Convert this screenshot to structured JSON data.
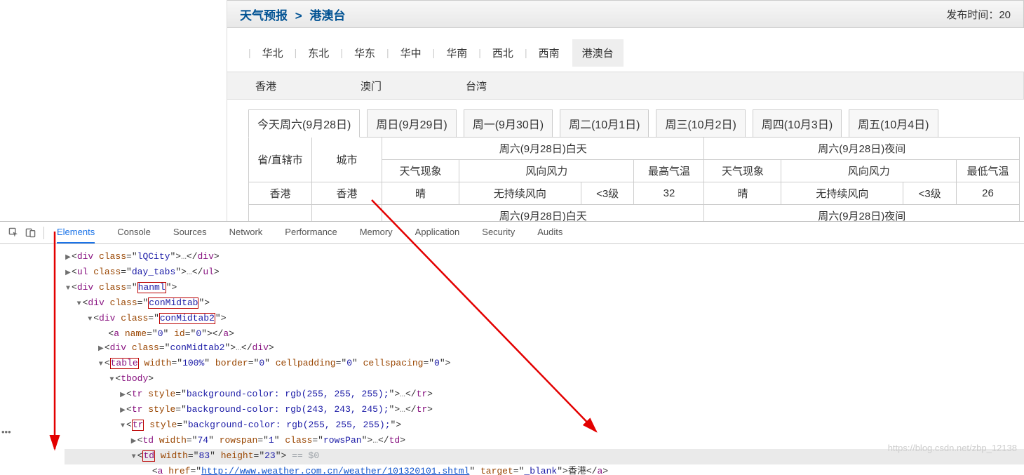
{
  "breadcrumb": {
    "root": "天气预报",
    "sep": ">",
    "leaf": "港澳台"
  },
  "pubtime_label": "发布时间：",
  "pubtime_val": "20",
  "regions": [
    "华北",
    "东北",
    "华东",
    "华中",
    "华南",
    "西北",
    "西南",
    "港澳台"
  ],
  "region_active": 7,
  "sub_regions": [
    "香港",
    "澳门",
    "台湾"
  ],
  "days": [
    "今天周六(9月28日)",
    "周日(9月29日)",
    "周一(9月30日)",
    "周二(10月1日)",
    "周三(10月2日)",
    "周四(10月3日)",
    "周五(10月4日)"
  ],
  "day_active": 0,
  "thead": {
    "province": "省/直辖市",
    "city": "城市",
    "day_group": "周六(9月28日)白天",
    "night_group": "周六(9月28日)夜间",
    "weather": "天气现象",
    "wind": "风向风力",
    "maxt": "最高气温",
    "mint": "最低气温"
  },
  "row": {
    "prov": "香港",
    "city": "香港",
    "dw": "晴",
    "ddir": "无持续风向",
    "dlvl": "<3级",
    "max": "32",
    "nw": "晴",
    "ndir": "无持续风向",
    "nlvl": "<3级",
    "min": "26"
  },
  "devtabs": [
    "Elements",
    "Console",
    "Sources",
    "Network",
    "Performance",
    "Memory",
    "Application",
    "Security",
    "Audits"
  ],
  "devtab_active": 0,
  "dom": {
    "l1": {
      "t": "div",
      "a": "class",
      "v": "lQCity"
    },
    "l2": {
      "t": "ul",
      "a": "class",
      "v": "day_tabs",
      "close": "ul"
    },
    "l3": {
      "t": "div",
      "a": "class",
      "v": "hanml"
    },
    "l4": {
      "t": "div",
      "a": "class",
      "v": "conMidtab"
    },
    "l5": {
      "t": "div",
      "a": "class",
      "v": "conMidtab2"
    },
    "l6": {
      "t": "a",
      "an": "name",
      "av": "0",
      "ai": "id",
      "aiv": "0",
      "close": "a"
    },
    "l7": {
      "t": "div",
      "a": "class",
      "v": "conMidtab2",
      "close": "div"
    },
    "l8": {
      "t": "table",
      "attrs": "width=\"100%\" border=\"0\" cellpadding=\"0\" cellspacing=\"0\""
    },
    "l9": {
      "t": "tbody"
    },
    "l10": {
      "t": "tr",
      "style": "background-color: rgb(255, 255, 255);",
      "close": "tr"
    },
    "l11": {
      "t": "tr",
      "style": "background-color: rgb(243, 243, 245);",
      "close": "tr"
    },
    "l12": {
      "t": "tr",
      "style": "background-color: rgb(255, 255, 255);"
    },
    "l13": {
      "t": "td",
      "attrs": "width=\"74\" rowspan=\"1\" class=\"rowsPan\"",
      "close": "td"
    },
    "l14": {
      "t": "td",
      "attrs": "width=\"83\" height=\"23\"",
      "sel": " == $0"
    },
    "l15": {
      "t": "a",
      "href": "http://www.weather.com.cn/weather/101320101.shtml",
      "target": "_blank",
      "text": "香港",
      "close": "a"
    }
  },
  "ellipsis": "•••",
  "watermark": "https://blog.csdn.net/zbp_12138"
}
